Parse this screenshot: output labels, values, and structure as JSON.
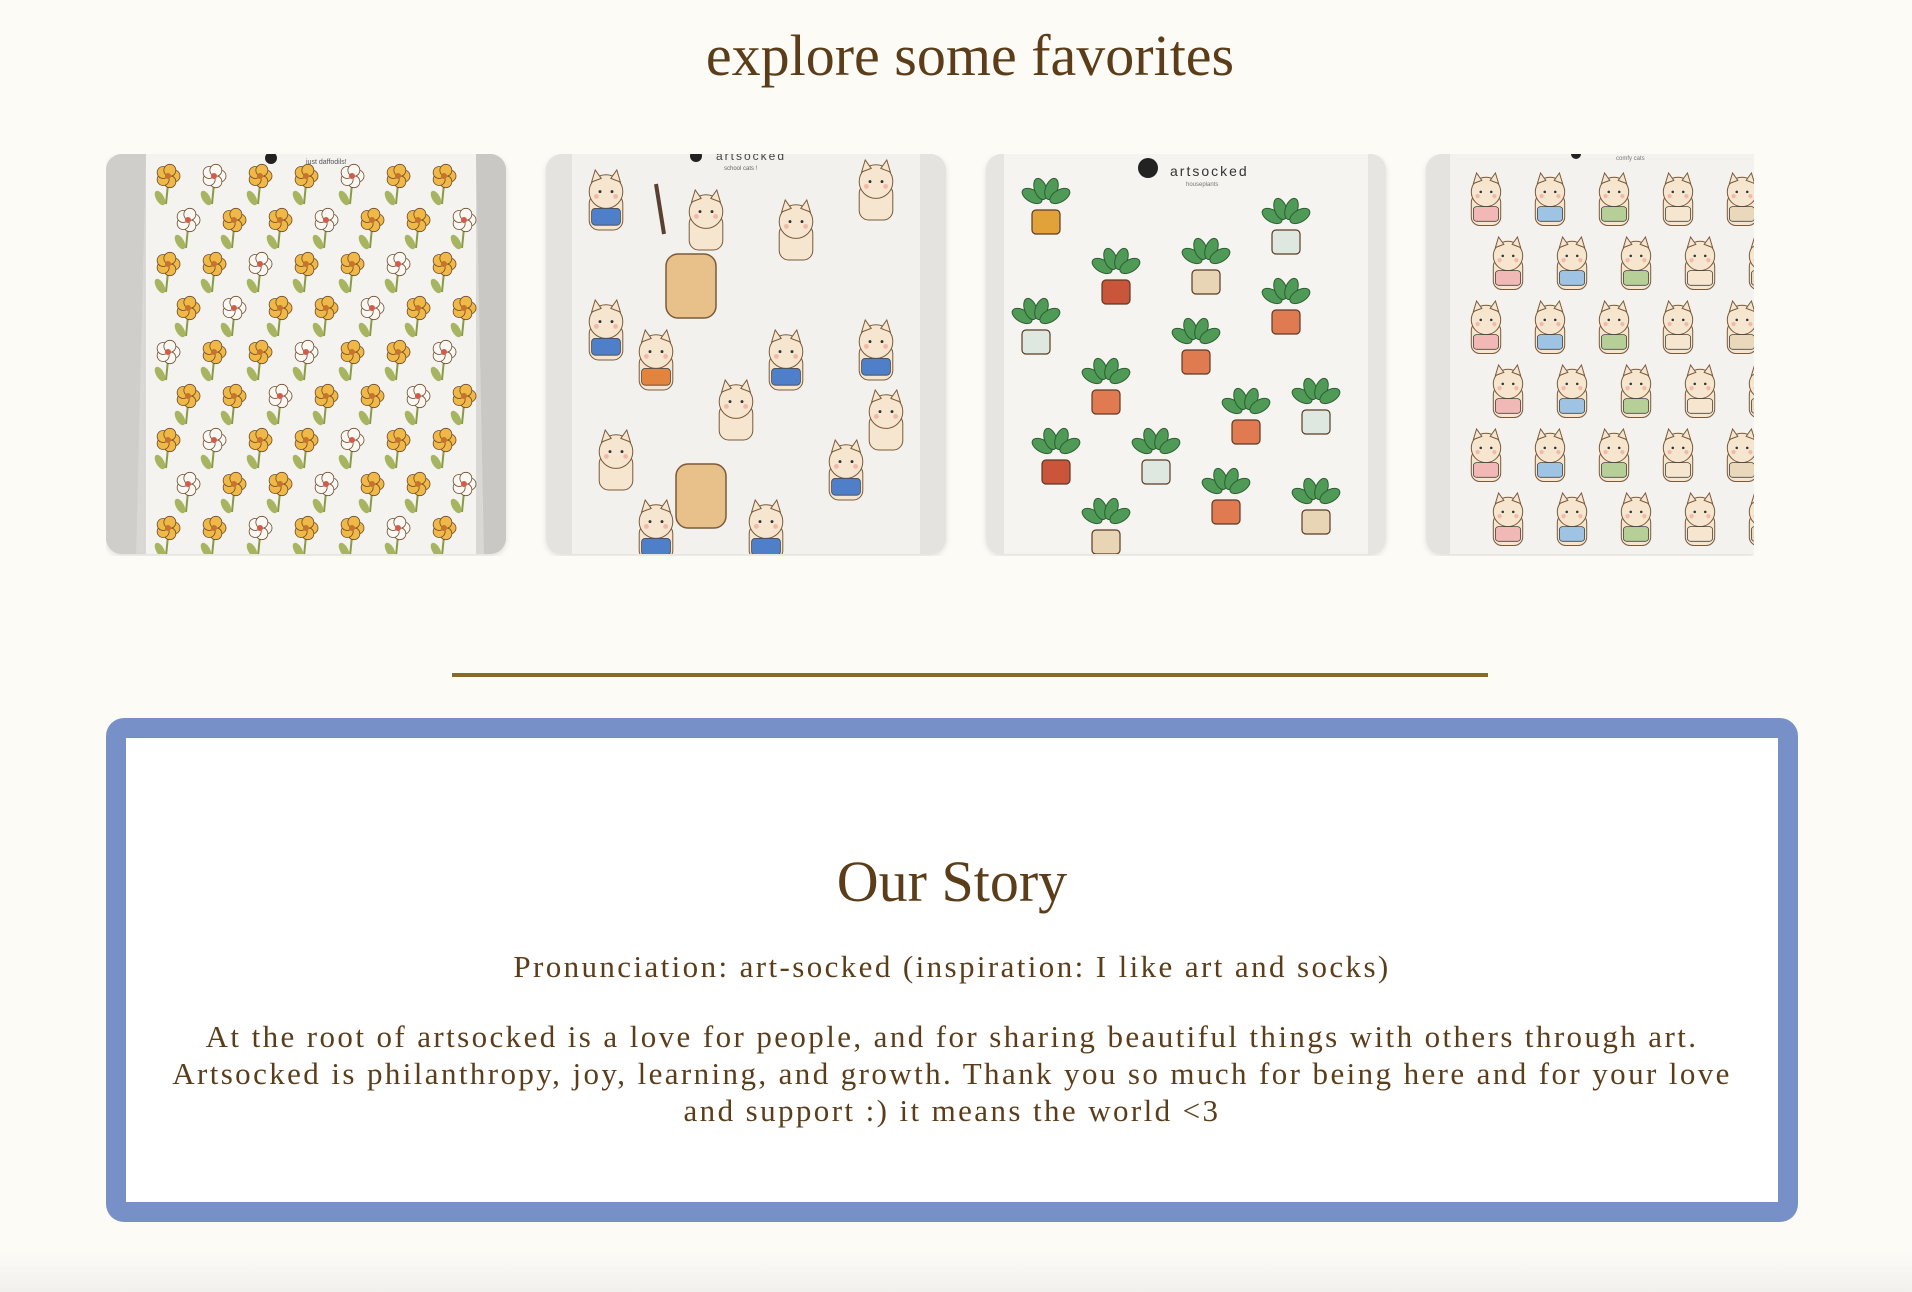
{
  "favorites": {
    "title": "explore some favorites",
    "products": [
      {
        "image": "sticker sheet with yellow and white flowers",
        "sheet_label": "just daffodils!"
      },
      {
        "image": "sticker sheet with cats carrying school backpacks",
        "brand": "artsocked",
        "sheet_label": "school cats !"
      },
      {
        "image": "sticker sheet with potted houseplants",
        "brand": "artsocked",
        "sheet_label": "houseplants"
      },
      {
        "image": "sticker sheet with cats in comfy hoodies and blankets",
        "sheet_label": "comfy cats"
      }
    ]
  },
  "story": {
    "title": "Our Story",
    "pronunciation": "Pronunciation: art-socked (inspiration: I like art and socks)",
    "body": "At the root of artsocked is a love for people, and for sharing beautiful things with others through art. Artsocked is philanthropy, joy, learning, and growth. Thank you so much for being here and for your love and support :) it means the world <3"
  },
  "colors": {
    "background": "#fdfbf6",
    "heading": "#5c3d1a",
    "divider": "#8a6a22",
    "story_border": "#7791c8"
  }
}
